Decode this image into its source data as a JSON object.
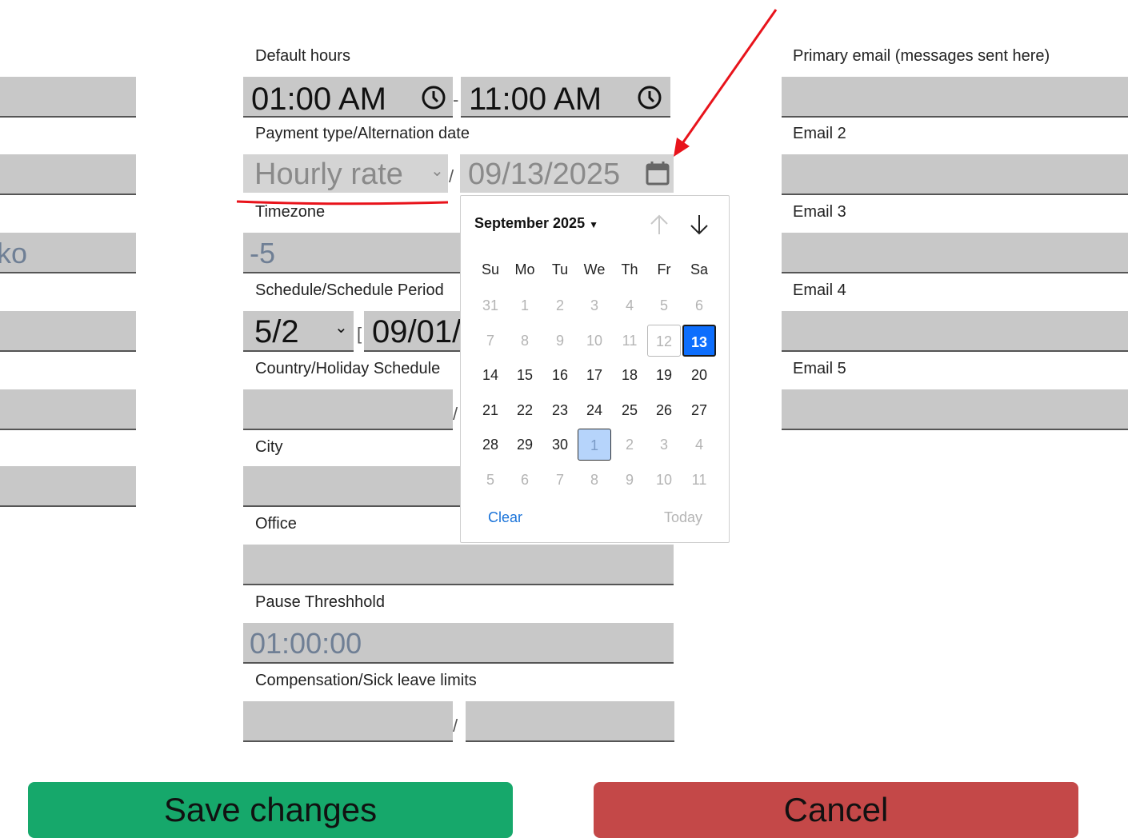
{
  "left_column": {
    "partial_text": "ko"
  },
  "default_hours": {
    "label": "Default hours",
    "start": "01:00 AM",
    "end": "11:00 AM",
    "separator": "-"
  },
  "payment": {
    "label": "Payment type/Alternation date",
    "type_value": "Hourly rate",
    "separator": "/",
    "date_value": "09/13/2025"
  },
  "timezone": {
    "label": "Timezone",
    "value": "-5"
  },
  "schedule": {
    "label": "Schedule/Schedule Period",
    "schedule_value": "5/2",
    "period_prefix": "[",
    "period_value": "09/01/"
  },
  "country": {
    "label": "Country/Holiday Schedule",
    "separator": "/"
  },
  "city": {
    "label": "City"
  },
  "office": {
    "label": "Office"
  },
  "pause": {
    "label": "Pause Threshhold",
    "placeholder": "01:00:00"
  },
  "compensation": {
    "label": "Compensation/Sick leave limits",
    "separator": "/"
  },
  "emails": {
    "primary_label": "Primary email (messages sent here)",
    "email2_label": "Email 2",
    "email3_label": "Email 3",
    "email4_label": "Email 4",
    "email5_label": "Email 5"
  },
  "datepicker": {
    "month_label": "September 2025",
    "weekdays": [
      "Su",
      "Mo",
      "Tu",
      "We",
      "Th",
      "Fr",
      "Sa"
    ],
    "weeks": [
      [
        "31",
        "1",
        "2",
        "3",
        "4",
        "5",
        "6"
      ],
      [
        "7",
        "8",
        "9",
        "10",
        "11",
        "12",
        "13"
      ],
      [
        "14",
        "15",
        "16",
        "17",
        "18",
        "19",
        "20"
      ],
      [
        "21",
        "22",
        "23",
        "24",
        "25",
        "26",
        "27"
      ],
      [
        "28",
        "29",
        "30",
        "1",
        "2",
        "3",
        "4"
      ],
      [
        "5",
        "6",
        "7",
        "8",
        "9",
        "10",
        "11"
      ]
    ],
    "selected_day": "13",
    "today_day": "12",
    "clear_label": "Clear",
    "today_label": "Today"
  },
  "buttons": {
    "save": "Save changes",
    "cancel": "Cancel"
  },
  "colors": {
    "save": "#16a86b",
    "cancel": "#c44848",
    "accent": "#0d6efd",
    "annotation": "#e8131b"
  }
}
